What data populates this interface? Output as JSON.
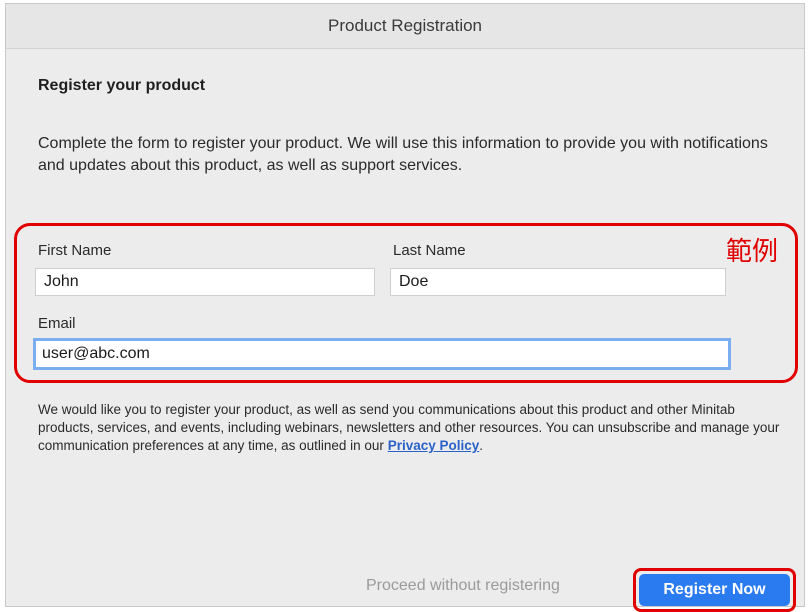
{
  "window": {
    "title": "Product Registration"
  },
  "heading": "Register your product",
  "intro": "Complete the form to register your product. We will use this information to provide you with notifications and updates about this product, as well as support services.",
  "form": {
    "first_name_label": "First Name",
    "first_name_value": "John",
    "last_name_label": "Last Name",
    "last_name_value": "Doe",
    "email_label": "Email",
    "email_value": "user@abc.com"
  },
  "annotation": {
    "example_label": "範例",
    "color": "#e00000"
  },
  "legal": {
    "text": "We would like you to register your product, as well as send you communications about this product and other Minitab products, services, and events, including webinars, newsletters and other resources. You can unsubscribe and manage your communication preferences at any time, as outlined in our ",
    "privacy_link": "Privacy Policy",
    "suffix": "."
  },
  "actions": {
    "proceed_label": "Proceed without registering",
    "register_label": "Register Now",
    "accent_color": "#2a7af0"
  }
}
